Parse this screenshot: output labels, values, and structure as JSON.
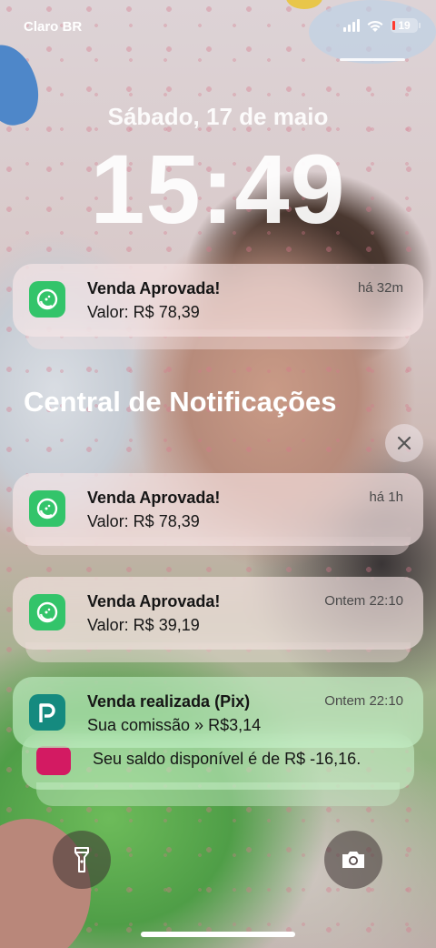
{
  "status_bar": {
    "carrier": "Claro BR",
    "battery_level": "19",
    "icons": [
      "signal-icon",
      "wifi-icon",
      "battery-icon"
    ]
  },
  "lock_screen": {
    "date": "Sábado, 17 de maio",
    "time": "15:49"
  },
  "pinned_notification": {
    "title": "Venda Aprovada!",
    "body": "Valor: R$ 78,39",
    "time": "há 32m",
    "icon": "lime-app-icon"
  },
  "notification_center": {
    "title": "Central de Notificações",
    "close_icon": "close-icon"
  },
  "notifications": [
    {
      "title": "Venda Aprovada!",
      "body": "Valor: R$ 78,39",
      "time": "há 1h",
      "icon": "lime-app-icon"
    },
    {
      "title": "Venda Aprovada!",
      "body": "Valor: R$ 39,19",
      "time": "Ontem 22:10",
      "icon": "lime-app-icon"
    },
    {
      "title": "Venda realizada (Pix)",
      "body": "Sua comissão » R$3,14",
      "time": "Ontem 22:10",
      "icon": "pix-app-icon"
    }
  ],
  "stacked_notification": {
    "body": "Seu saldo disponível é de R$ -16,16.",
    "icon": "wallet-app-icon"
  },
  "quick_actions": {
    "left": "flashlight-icon",
    "right": "camera-icon"
  },
  "colors": {
    "lime_app": "#33c46a",
    "pix_app": "#158a7f",
    "wallet_app": "#d31a62",
    "battery_low": "#ff3b30"
  }
}
